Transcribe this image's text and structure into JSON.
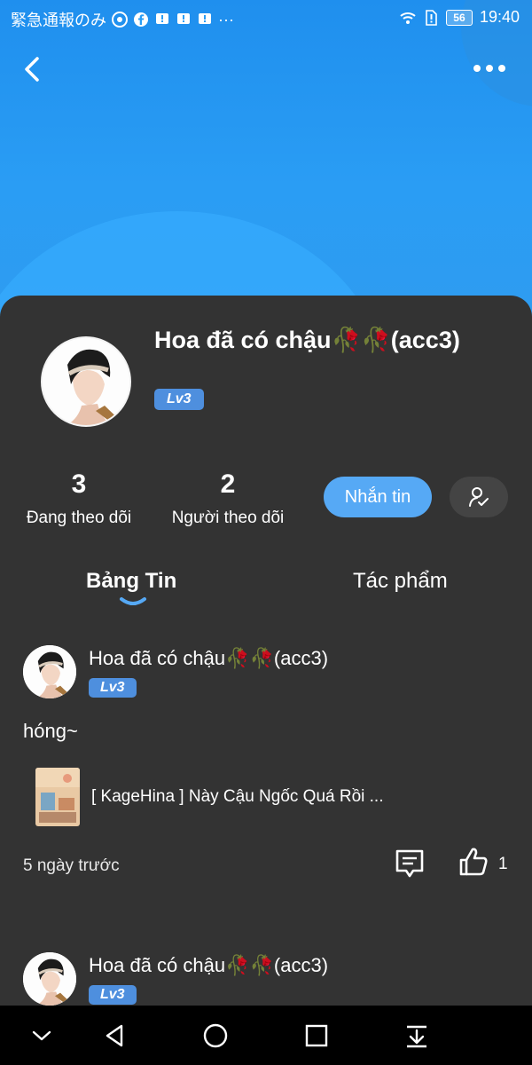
{
  "status_bar": {
    "left_text": "緊急通報のみ",
    "overflow": "···",
    "battery": "56",
    "time": "19:40"
  },
  "profile": {
    "name": "Hoa đã có chậu🥀🥀(acc3)",
    "level": "Lv3",
    "following_count": "3",
    "following_label": "Đang theo dõi",
    "followers_count": "2",
    "followers_label": "Người theo dõi",
    "message_button": "Nhắn tin"
  },
  "tabs": [
    {
      "label": "Bảng Tin",
      "active": true
    },
    {
      "label": "Tác phẩm",
      "active": false
    }
  ],
  "posts": [
    {
      "author": "Hoa đã có chậu🥀🥀(acc3)",
      "level": "Lv3",
      "text": "hóng~",
      "attachment_title": "[ KageHina ] Này Cậu Ngốc Quá Rồi ...",
      "time": "5 ngày trước",
      "like_count": "1"
    },
    {
      "author": "Hoa đã có chậu🥀🥀(acc3)",
      "level": "Lv3"
    }
  ],
  "colors": {
    "header_blue": "#2a9df4",
    "accent": "#56a9f5",
    "level_badge": "#4e8fde",
    "card_bg": "#333333"
  }
}
